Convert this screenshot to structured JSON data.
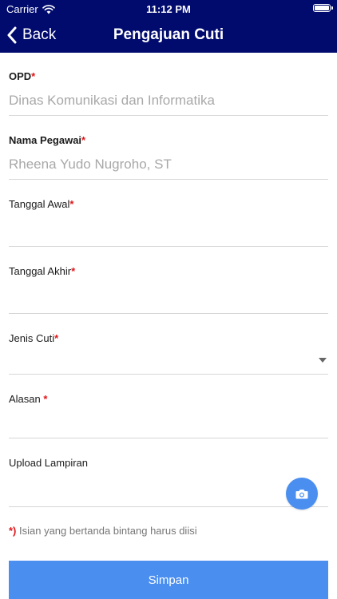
{
  "status_bar": {
    "carrier": "Carrier",
    "time": "11:12 PM",
    "wifi_icon": "wifi-icon",
    "battery_icon": "battery-icon"
  },
  "nav": {
    "back_label": "Back",
    "title": "Pengajuan Cuti",
    "bar_color": "#010b6e"
  },
  "required_marker": "*",
  "form": {
    "opd": {
      "label": "OPD",
      "value": "Dinas Komunikasi dan Informatika"
    },
    "nama_pegawai": {
      "label": "Nama Pegawai",
      "value": "Rheena Yudo Nugroho, ST"
    },
    "tanggal_awal": {
      "label": "Tanggal Awal",
      "value": ""
    },
    "tanggal_akhir": {
      "label": "Tanggal Akhir",
      "value": ""
    },
    "jenis_cuti": {
      "label": "Jenis Cuti",
      "value": ""
    },
    "alasan": {
      "label": "Alasan ",
      "value": ""
    },
    "upload_lampiran": {
      "label": "Upload Lampiran",
      "icon": "camera-icon"
    }
  },
  "note": {
    "marker": "*)",
    "text": " Isian yang bertanda bintang harus diisi"
  },
  "submit_label": "Simpan",
  "colors": {
    "accent": "#4a8ef0",
    "required": "#e0171b"
  }
}
